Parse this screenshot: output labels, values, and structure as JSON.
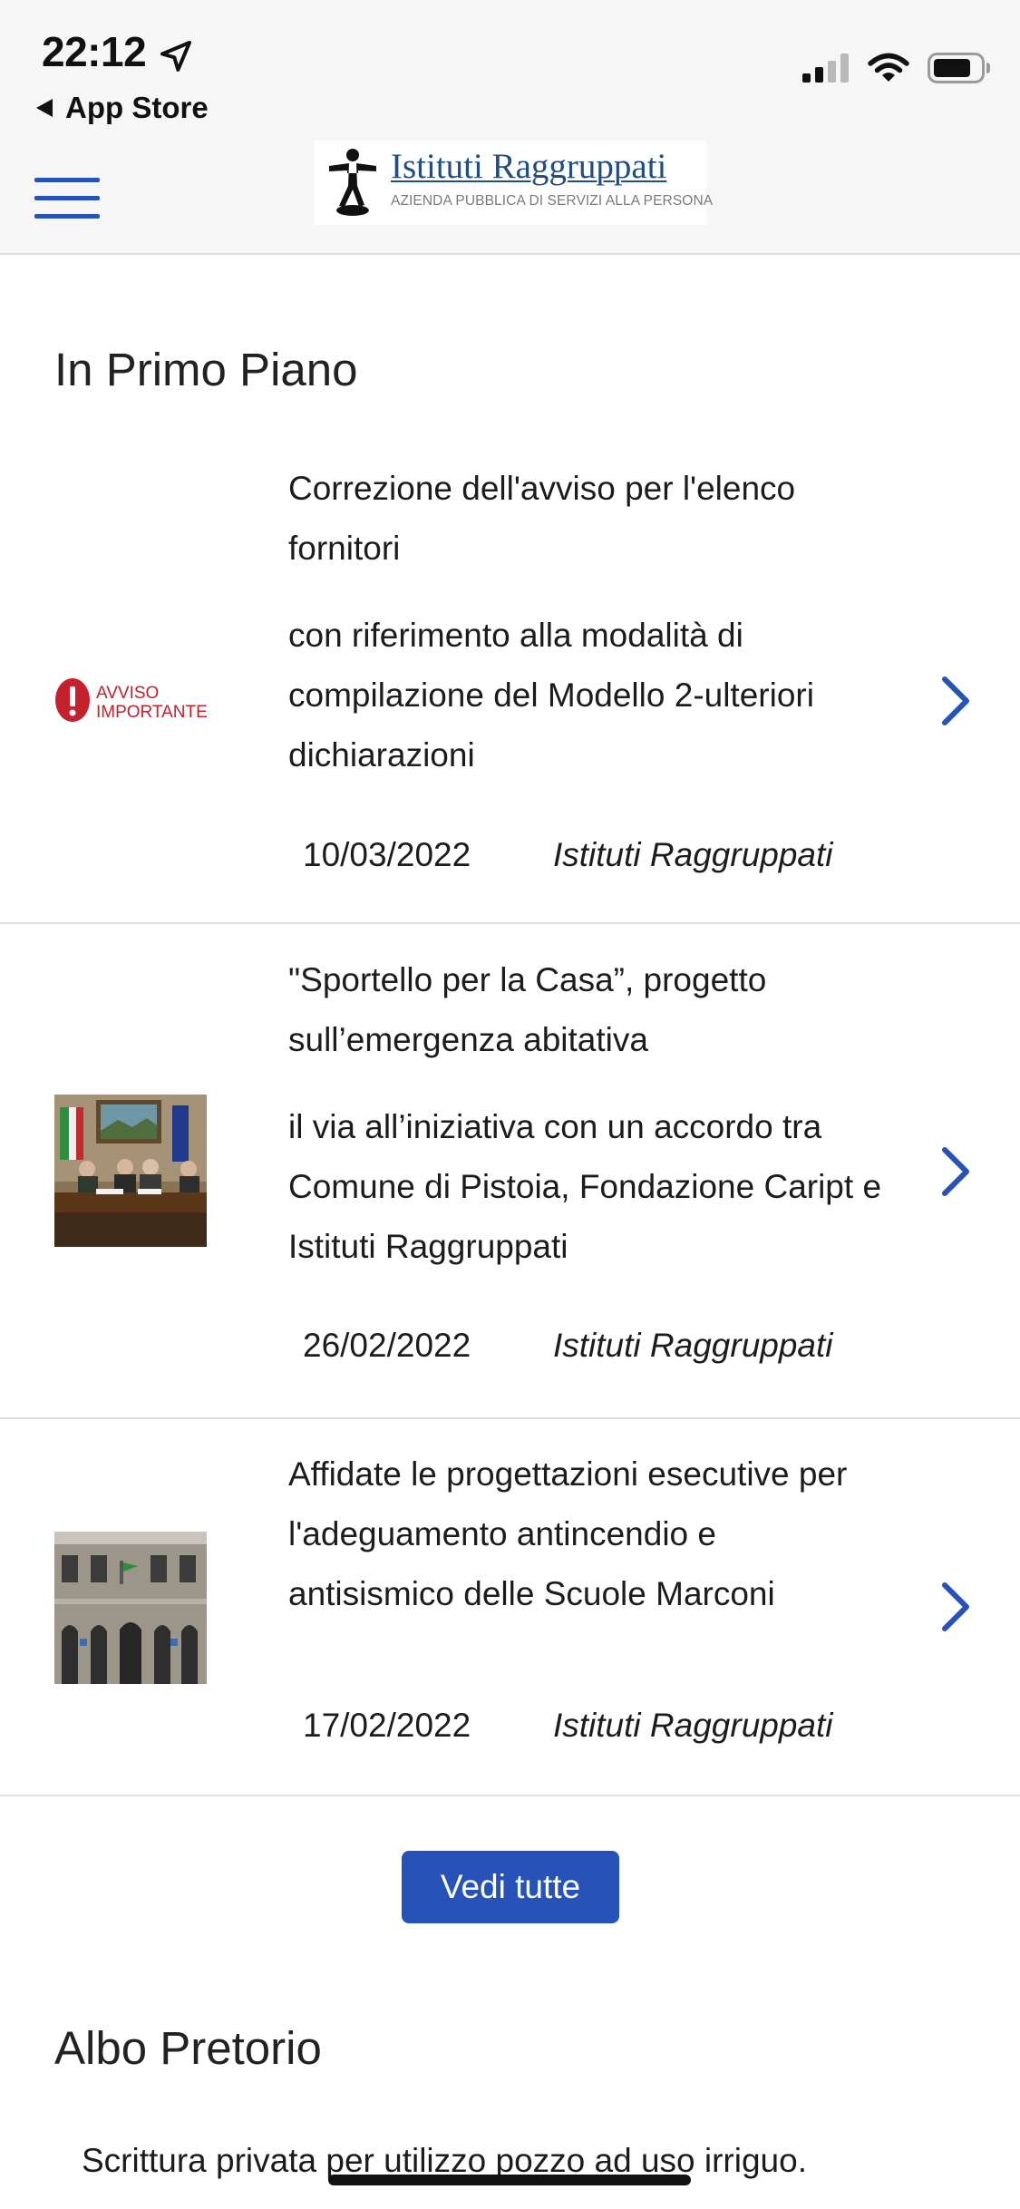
{
  "status_bar": {
    "time": "22:12",
    "back_label": "App Store"
  },
  "header": {
    "logo_title": "Istituti Raggruppati",
    "logo_subtitle": "AZIENDA PUBBLICA DI SERVIZI ALLA PERSONA"
  },
  "primo_piano": {
    "heading": "In Primo Piano",
    "items": [
      {
        "title": "Correzione dell'avviso per l'elenco fornitori",
        "description": "con riferimento alla modalità di compilazione del Modello 2-ulteriori dichiarazioni",
        "date": "10/03/2022",
        "source": "Istituti Raggruppati",
        "thumb_label_1": "AVVISO",
        "thumb_label_2": "IMPORTANTE"
      },
      {
        "title": "\"Sportello per la Casa”, progetto sull’emergenza abitativa",
        "description": "il via all’iniziativa con un accordo tra Comune di Pistoia, Fondazione Caript e Istituti Raggruppati",
        "date": "26/02/2022",
        "source": "Istituti Raggruppati"
      },
      {
        "title": "Affidate le progettazioni esecutive per l'adeguamento antincendio e antisismico delle Scuole Marconi",
        "date": "17/02/2022",
        "source": "Istituti Raggruppati"
      }
    ],
    "more_button": "Vedi tutte"
  },
  "albo_pretorio": {
    "heading": "Albo Pretorio",
    "first_item": "Scrittura privata per utilizzo pozzo ad uso irriguo."
  },
  "colors": {
    "accent": "#2752b8",
    "header_bg": "#f6f6f6",
    "logo_blue": "#1f4f82",
    "avviso_red": "#c4202e"
  },
  "icons": {
    "menu": "hamburger-menu-icon",
    "chevron": "chevron-right-icon",
    "location": "location-arrow-icon"
  }
}
